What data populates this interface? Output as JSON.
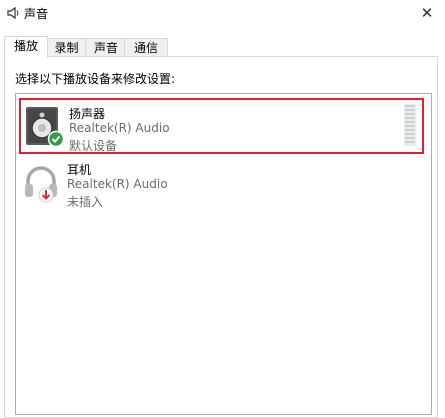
{
  "window": {
    "title": "声音",
    "close_glyph": "✕"
  },
  "tabs": [
    {
      "label": "播放",
      "active": true
    },
    {
      "label": "录制",
      "active": false
    },
    {
      "label": "声音",
      "active": false
    },
    {
      "label": "通信",
      "active": false
    }
  ],
  "playback": {
    "instruction": "选择以下播放设备来修改设置:",
    "devices": [
      {
        "name": "扬声器",
        "description": "Realtek(R) Audio",
        "status": "默认设备",
        "icon": "speaker-icon",
        "badge": "default-check-icon",
        "selected": true
      },
      {
        "name": "耳机",
        "description": "Realtek(R) Audio",
        "status": "未插入",
        "icon": "headphones-icon",
        "badge": "unplugged-arrow-icon",
        "selected": false
      }
    ]
  },
  "colors": {
    "selection_highlight": "#e0212b",
    "default_badge": "#2ea043",
    "unplugged_badge": "#d9302c"
  }
}
